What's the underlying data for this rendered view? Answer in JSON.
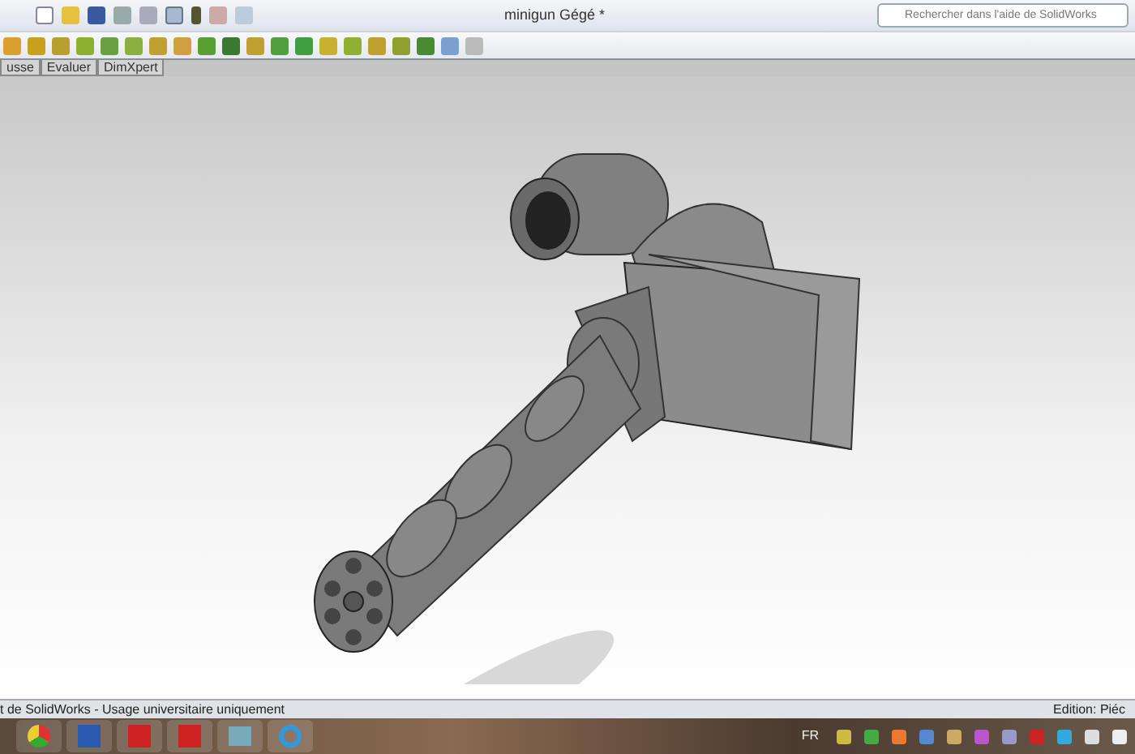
{
  "window": {
    "title": "minigun Gégé *"
  },
  "search": {
    "placeholder": "Rechercher dans l'aide de SolidWorks"
  },
  "tabs": [
    {
      "label": "usse",
      "selected": false
    },
    {
      "label": "Evaluer",
      "selected": false
    },
    {
      "label": "DimXpert",
      "selected": false
    }
  ],
  "status_bar": {
    "left": "t de SolidWorks - Usage universitaire uniquement",
    "right": "Edition: Piéc"
  },
  "taskbar": {
    "language": "FR"
  }
}
